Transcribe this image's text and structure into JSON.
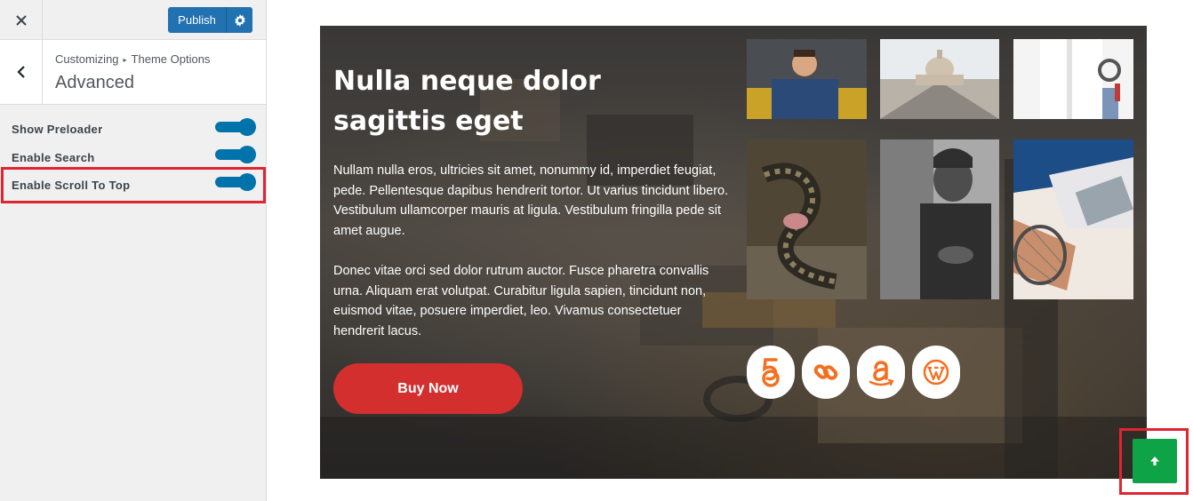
{
  "header": {
    "close_icon": "close-icon",
    "publish_label": "Publish",
    "settings_icon": "gear-icon"
  },
  "section": {
    "breadcrumb_root": "Customizing",
    "breadcrumb_separator": "▸",
    "breadcrumb_current": "Theme Options",
    "title": "Advanced"
  },
  "options": [
    {
      "label": "Show Preloader",
      "enabled": true
    },
    {
      "label": "Enable Search",
      "enabled": true
    },
    {
      "label": "Enable Scroll To Top",
      "enabled": true
    }
  ],
  "hero": {
    "title": "Nulla neque dolor sagittis eget",
    "paragraph1": "Nullam nulla eros, ultricies sit amet, nonummy id, imperdiet feugiat, pede. Pellentesque dapibus hendrerit tortor. Ut varius tincidunt libero. Vestibulum ullamcorper mauris at ligula. Vestibulum fringilla pede sit amet augue.",
    "paragraph2": "Donec vitae orci sed dolor rutrum auctor. Fusce pharetra convallis urna. Aliquam erat volutpat. Curabitur ligula sapien, tincidunt non, euismod vitae, posuere imperdiet, leo. Vivamus consectetuer hendrerit lacus.",
    "button_label": "Buy Now"
  },
  "gallery_icons": [
    "man-reading-photo",
    "city-bridge-photo",
    "doctor-stethoscope-photo",
    "snake-photo",
    "old-man-photo",
    "laptop-tennis-photo"
  ],
  "social_icons": [
    "500px-icon",
    "link-icon",
    "amazon-icon",
    "wordpress-icon"
  ],
  "colors": {
    "accent": "#2271b1",
    "toggle": "#0073aa",
    "buy_button": "#d32f2f",
    "social_icon": "#f37021",
    "scroll_top": "#0fa347",
    "highlight": "#e02430"
  },
  "scroll_top_icon": "arrow-up-icon"
}
